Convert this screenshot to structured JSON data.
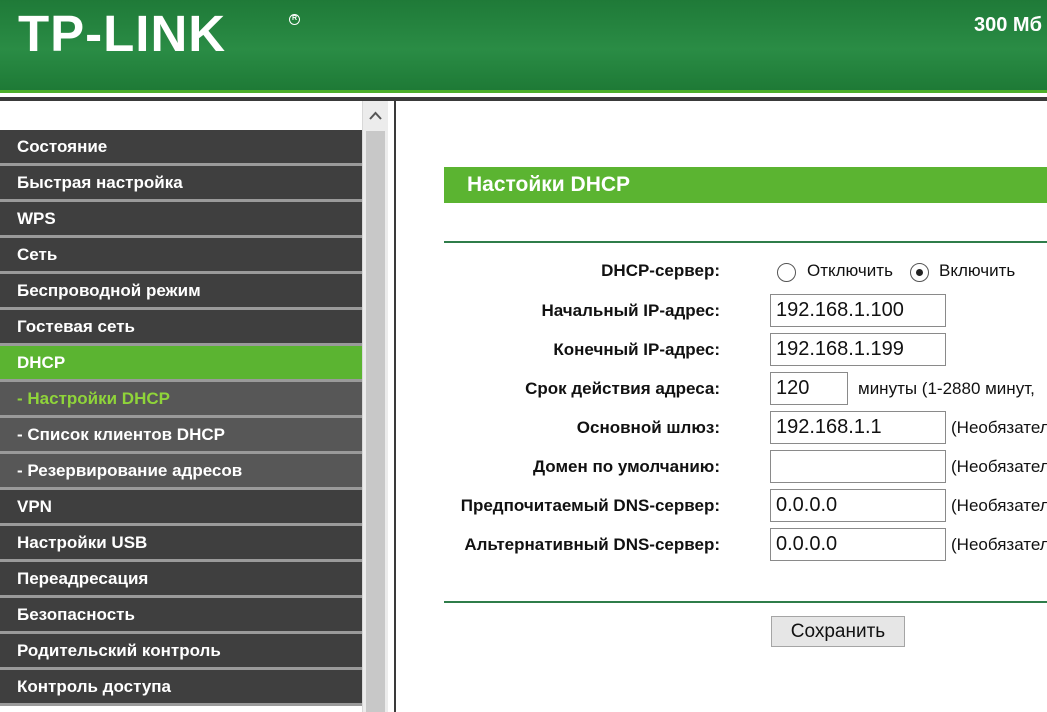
{
  "header": {
    "logo": "TP-LINK",
    "logo_mark": "R",
    "model": "300 Мб"
  },
  "sidebar": {
    "items": [
      {
        "label": "Состояние"
      },
      {
        "label": "Быстрая настройка"
      },
      {
        "label": "WPS"
      },
      {
        "label": "Сеть"
      },
      {
        "label": "Беспроводной режим"
      },
      {
        "label": "Гостевая сеть"
      },
      {
        "label": "DHCP"
      },
      {
        "label": "- Настройки DHCP"
      },
      {
        "label": "- Список клиентов DHCP"
      },
      {
        "label": "- Резервирование адресов"
      },
      {
        "label": "VPN"
      },
      {
        "label": "Настройки USB"
      },
      {
        "label": "Переадресация"
      },
      {
        "label": "Безопасность"
      },
      {
        "label": "Родительский контроль"
      },
      {
        "label": "Контроль доступа"
      }
    ],
    "scroll_up_icon": "chevron-up-icon"
  },
  "main": {
    "title": "Настойки DHCP",
    "dhcp_server": {
      "label": "DHCP-сервер:",
      "off_label": "Отключить",
      "on_label": "Включить",
      "selected": "on"
    },
    "fields": {
      "start_ip": {
        "label": "Начальный IP-адрес:",
        "value": "192.168.1.100"
      },
      "end_ip": {
        "label": "Конечный IP-адрес:",
        "value": "192.168.1.199"
      },
      "lease": {
        "label": "Срок действия адреса:",
        "value": "120",
        "note": "минуты (1-2880 минут,"
      },
      "gateway": {
        "label": "Основной шлюз:",
        "value": "192.168.1.1",
        "note": "(Необязател"
      },
      "domain": {
        "label": "Домен по умолчанию:",
        "value": "",
        "note": "(Необязател"
      },
      "dns1": {
        "label": "Предпочитаемый DNS-сервер:",
        "value": "0.0.0.0",
        "note": "(Необязател"
      },
      "dns2": {
        "label": "Альтернативный DNS-сервер:",
        "value": "0.0.0.0",
        "note": "(Необязател"
      }
    },
    "save_label": "Сохранить"
  },
  "colors": {
    "brand_green": "#2a8c45",
    "accent_green": "#5bb431",
    "menu_dark": "#3f3f3f",
    "current_sub": "#8fd43a"
  }
}
